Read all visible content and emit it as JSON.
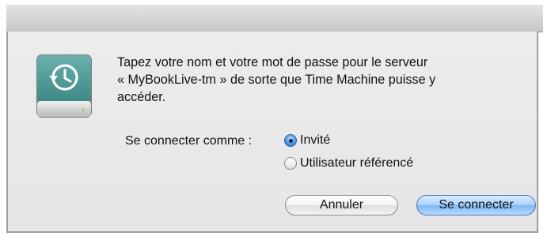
{
  "dialog": {
    "message_lines": [
      "Tapez votre nom et votre mot de passe pour le serveur",
      "« MyBookLive-tm » de sorte que Time Machine puisse y",
      "accéder."
    ],
    "connect_as_label": "Se connecter comme :",
    "options": [
      {
        "label": "Invité",
        "selected": true
      },
      {
        "label": "Utilisateur référencé",
        "selected": false
      }
    ],
    "buttons": {
      "cancel_label": "Annuler",
      "connect_label": "Se connecter"
    }
  },
  "icons": {
    "drive": "time-machine-drive-icon"
  },
  "colors": {
    "dialog_background": "#e8e8e8",
    "drive_teal": "#4f9a98",
    "default_button_blue": "#8cc3f7"
  }
}
